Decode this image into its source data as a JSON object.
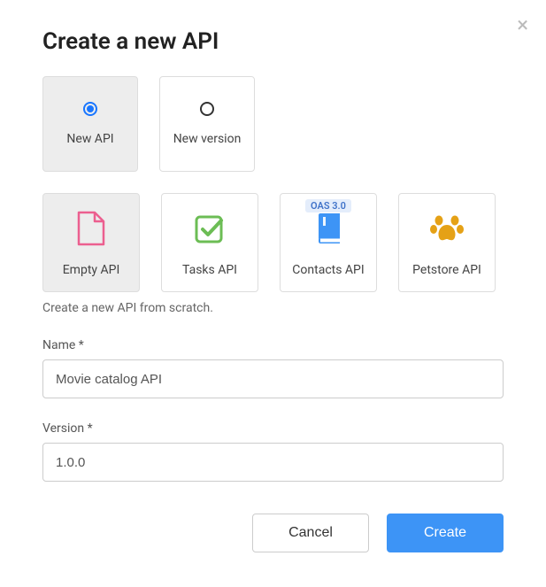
{
  "title": "Create a new API",
  "typeOptions": {
    "newApi": "New API",
    "newVersion": "New version"
  },
  "templates": {
    "empty": {
      "label": "Empty API"
    },
    "tasks": {
      "label": "Tasks API"
    },
    "contacts": {
      "label": "Contacts API",
      "badge": "OAS 3.0"
    },
    "petstore": {
      "label": "Petstore API"
    }
  },
  "description": "Create a new API from scratch.",
  "fields": {
    "name": {
      "label": "Name *",
      "value": "Movie catalog API"
    },
    "version": {
      "label": "Version *",
      "value": "1.0.0"
    }
  },
  "buttons": {
    "cancel": "Cancel",
    "create": "Create"
  }
}
